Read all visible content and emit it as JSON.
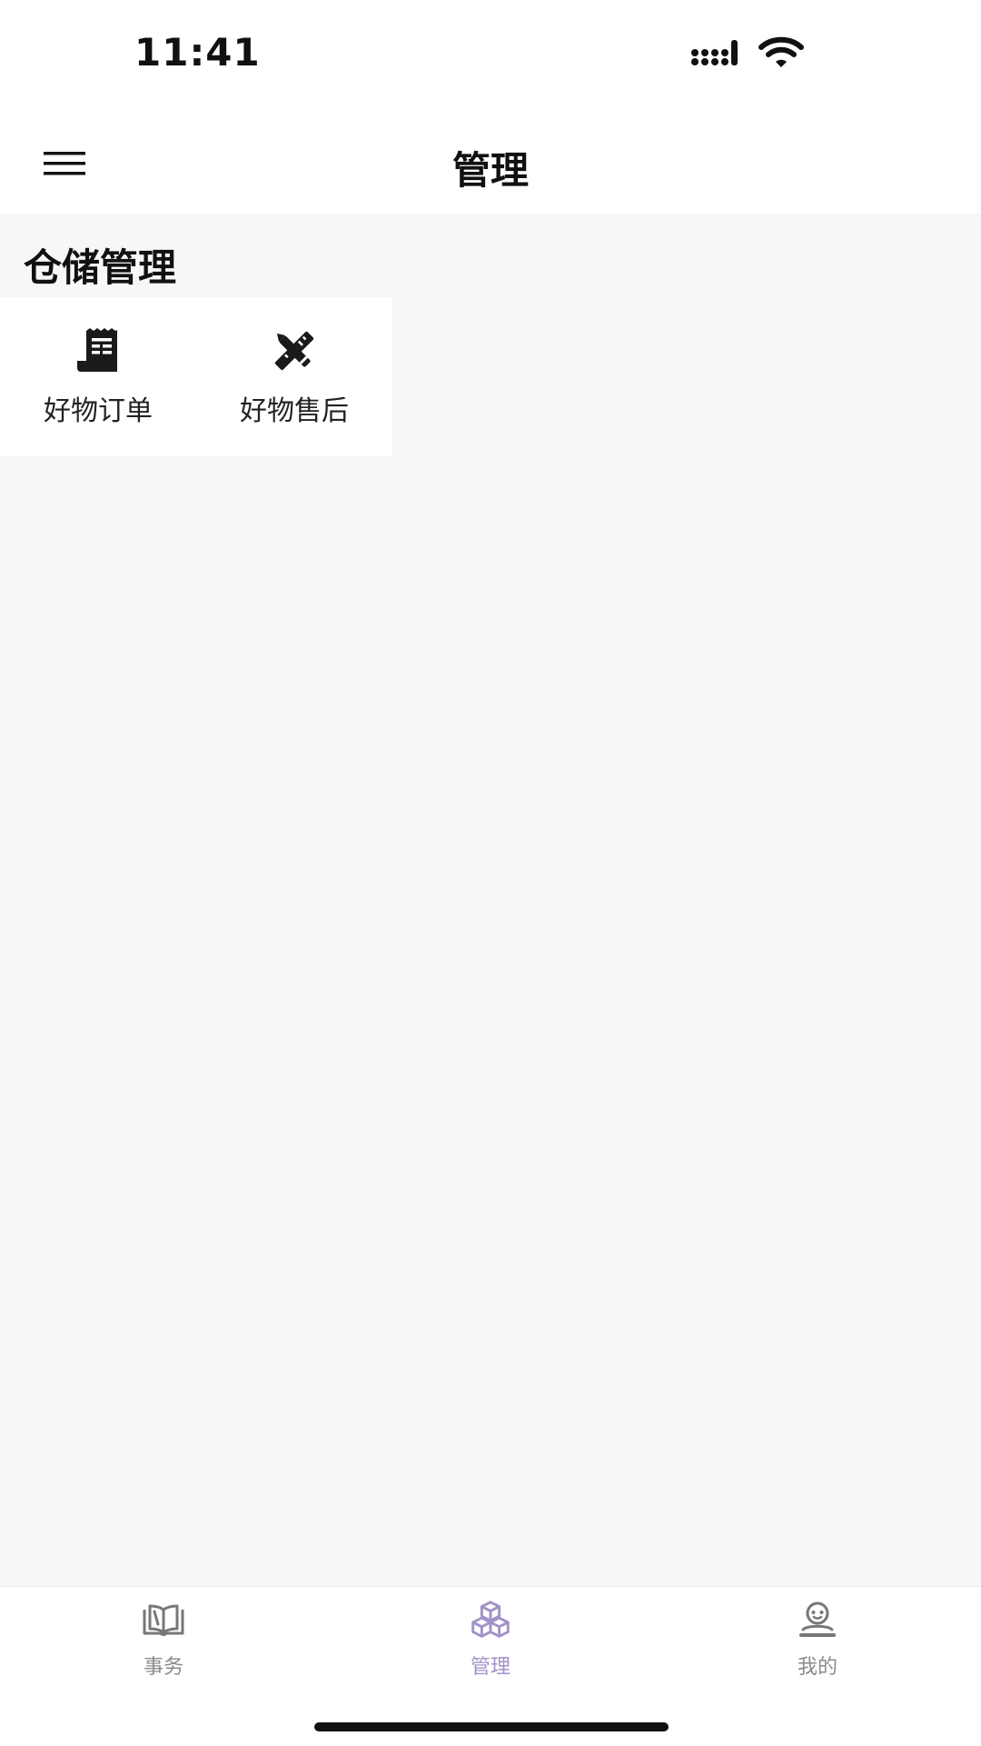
{
  "status_bar": {
    "time": "11:41"
  },
  "nav": {
    "title": "管理",
    "menu_icon": "hamburger-menu-icon"
  },
  "section": {
    "title": "仓储管理",
    "items": [
      {
        "label": "好物订单",
        "icon": "receipt-icon"
      },
      {
        "label": "好物售后",
        "icon": "tools-icon"
      }
    ]
  },
  "tabbar": {
    "active_tab": "管理",
    "tabs": [
      {
        "label": "事务",
        "icon": "book-icon"
      },
      {
        "label": "管理",
        "icon": "cubes-icon"
      },
      {
        "label": "我的",
        "icon": "user-icon"
      }
    ]
  },
  "colors": {
    "accent": "#a291c8",
    "content_background": "#f7f7f7",
    "inactive_tab": "#8a8a8a"
  }
}
